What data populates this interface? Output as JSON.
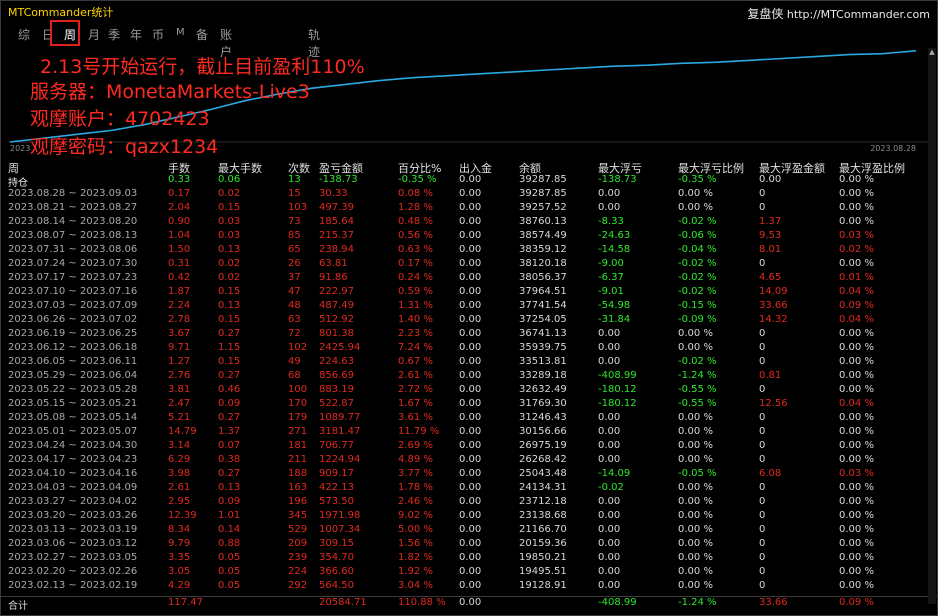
{
  "app_title": "MTCommander统计",
  "brand": {
    "name": "复盘侠",
    "url": "http://MTCommander.com"
  },
  "tabs": [
    "综",
    "日",
    "周",
    "月",
    "季",
    "年",
    "币",
    "M",
    "备",
    "账户",
    "轨迹"
  ],
  "active_tab": "周",
  "overlay_lines": [
    "2.13号开始运行，截止目前盈利110%",
    "服务器：MonetaMarkets-Live3",
    "观摩账户：4702423",
    "观摩密码：qazx1234"
  ],
  "chart_data": {
    "type": "area",
    "x_start_label": "2023",
    "x_end_label": "2023.08.28",
    "values": [
      0.0,
      0.04,
      0.08,
      0.12,
      0.18,
      0.26,
      0.34,
      0.43,
      0.5,
      0.56,
      0.6,
      0.64,
      0.67,
      0.69,
      0.71,
      0.73,
      0.75,
      0.77,
      0.79,
      0.8,
      0.82,
      0.83,
      0.85,
      0.87,
      0.89,
      0.91,
      0.92,
      0.95
    ]
  },
  "table": {
    "headers": [
      "周",
      "手数",
      "最大手数",
      "次数",
      "盈亏金额",
      "百分比%",
      "出入金",
      "余额",
      "最大浮亏",
      "最大浮亏比例",
      "最大浮盈金额",
      "最大浮盈比例"
    ],
    "rows": [
      [
        "持仓",
        "0.33",
        "0.06",
        "13",
        "-138.73",
        "-0.35 %",
        "0.00",
        "39287.85",
        "-138.73",
        "-0.35 %",
        "0.00",
        "0.00 %"
      ],
      [
        "2023.08.28 ~ 2023.09.03",
        "0.17",
        "0.02",
        "15",
        "30.33",
        "0.08 %",
        "0.00",
        "39287.85",
        "0.00",
        "0.00 %",
        "0",
        "0.00 %"
      ],
      [
        "2023.08.21 ~ 2023.08.27",
        "2.04",
        "0.15",
        "103",
        "497.39",
        "1.28 %",
        "0.00",
        "39257.52",
        "0.00",
        "0.00 %",
        "0",
        "0.00 %"
      ],
      [
        "2023.08.14 ~ 2023.08.20",
        "0.90",
        "0.03",
        "73",
        "185.64",
        "0.48 %",
        "0.00",
        "38760.13",
        "-8.33",
        "-0.02 %",
        "1.37",
        "0.00 %"
      ],
      [
        "2023.08.07 ~ 2023.08.13",
        "1.04",
        "0.03",
        "85",
        "215.37",
        "0.56 %",
        "0.00",
        "38574.49",
        "-24.63",
        "-0.06 %",
        "9.53",
        "0.03 %"
      ],
      [
        "2023.07.31 ~ 2023.08.06",
        "1.50",
        "0.13",
        "65",
        "238.94",
        "0.63 %",
        "0.00",
        "38359.12",
        "-14.58",
        "-0.04 %",
        "8.01",
        "0.02 %"
      ],
      [
        "2023.07.24 ~ 2023.07.30",
        "0.31",
        "0.02",
        "26",
        "63.81",
        "0.17 %",
        "0.00",
        "38120.18",
        "-9.00",
        "-0.02 %",
        "0",
        "0.00 %"
      ],
      [
        "2023.07.17 ~ 2023.07.23",
        "0.42",
        "0.02",
        "37",
        "91.86",
        "0.24 %",
        "0.00",
        "38056.37",
        "-6.37",
        "-0.02 %",
        "4.65",
        "0.01 %"
      ],
      [
        "2023.07.10 ~ 2023.07.16",
        "1.87",
        "0.15",
        "47",
        "222.97",
        "0.59 %",
        "0.00",
        "37964.51",
        "-9.01",
        "-0.02 %",
        "14.09",
        "0.04 %"
      ],
      [
        "2023.07.03 ~ 2023.07.09",
        "2.24",
        "0.13",
        "48",
        "487.49",
        "1.31 %",
        "0.00",
        "37741.54",
        "-54.98",
        "-0.15 %",
        "33.66",
        "0.09 %"
      ],
      [
        "2023.06.26 ~ 2023.07.02",
        "2.78",
        "0.15",
        "63",
        "512.92",
        "1.40 %",
        "0.00",
        "37254.05",
        "-31.84",
        "-0.09 %",
        "14.32",
        "0.04 %"
      ],
      [
        "2023.06.19 ~ 2023.06.25",
        "3.67",
        "0.27",
        "72",
        "801.38",
        "2.23 %",
        "0.00",
        "36741.13",
        "0.00",
        "0.00 %",
        "0",
        "0.00 %"
      ],
      [
        "2023.06.12 ~ 2023.06.18",
        "9.71",
        "1.15",
        "102",
        "2425.94",
        "7.24 %",
        "0.00",
        "35939.75",
        "0.00",
        "0.00 %",
        "0",
        "0.00 %"
      ],
      [
        "2023.06.05 ~ 2023.06.11",
        "1.27",
        "0.15",
        "49",
        "224.63",
        "0.67 %",
        "0.00",
        "33513.81",
        "0.00",
        "-0.02 %",
        "0",
        "0.00 %"
      ],
      [
        "2023.05.29 ~ 2023.06.04",
        "2.76",
        "0.27",
        "68",
        "856.69",
        "2.61 %",
        "0.00",
        "33289.18",
        "-408.99",
        "-1.24 %",
        "0.81",
        "0.00 %"
      ],
      [
        "2023.05.22 ~ 2023.05.28",
        "3.81",
        "0.46",
        "100",
        "883.19",
        "2.72 %",
        "0.00",
        "32632.49",
        "-180.12",
        "-0.55 %",
        "0",
        "0.00 %"
      ],
      [
        "2023.05.15 ~ 2023.05.21",
        "2.47",
        "0.09",
        "170",
        "522.87",
        "1.67 %",
        "0.00",
        "31769.30",
        "-180.12",
        "-0.55 %",
        "12.56",
        "0.04 %"
      ],
      [
        "2023.05.08 ~ 2023.05.14",
        "5.21",
        "0.27",
        "179",
        "1089.77",
        "3.61 %",
        "0.00",
        "31246.43",
        "0.00",
        "0.00 %",
        "0",
        "0.00 %"
      ],
      [
        "2023.05.01 ~ 2023.05.07",
        "14.79",
        "1.37",
        "271",
        "3181.47",
        "11.79 %",
        "0.00",
        "30156.66",
        "0.00",
        "0.00 %",
        "0",
        "0.00 %"
      ],
      [
        "2023.04.24 ~ 2023.04.30",
        "3.14",
        "0.07",
        "181",
        "706.77",
        "2.69 %",
        "0.00",
        "26975.19",
        "0.00",
        "0.00 %",
        "0",
        "0.00 %"
      ],
      [
        "2023.04.17 ~ 2023.04.23",
        "6.29",
        "0.38",
        "211",
        "1224.94",
        "4.89 %",
        "0.00",
        "26268.42",
        "0.00",
        "0.00 %",
        "0",
        "0.00 %"
      ],
      [
        "2023.04.10 ~ 2023.04.16",
        "3.98",
        "0.27",
        "188",
        "909.17",
        "3.77 %",
        "0.00",
        "25043.48",
        "-14.09",
        "-0.05 %",
        "6.08",
        "0.03 %"
      ],
      [
        "2023.04.03 ~ 2023.04.09",
        "2.61",
        "0.13",
        "163",
        "422.13",
        "1.78 %",
        "0.00",
        "24134.31",
        "-0.02",
        "0.00 %",
        "0",
        "0.00 %"
      ],
      [
        "2023.03.27 ~ 2023.04.02",
        "2.95",
        "0.09",
        "196",
        "573.50",
        "2.46 %",
        "0.00",
        "23712.18",
        "0.00",
        "0.00 %",
        "0",
        "0.00 %"
      ],
      [
        "2023.03.20 ~ 2023.03.26",
        "12.39",
        "1.01",
        "345",
        "1971.98",
        "9.02 %",
        "0.00",
        "23138.68",
        "0.00",
        "0.00 %",
        "0",
        "0.00 %"
      ],
      [
        "2023.03.13 ~ 2023.03.19",
        "8.34",
        "0.14",
        "529",
        "1007.34",
        "5.00 %",
        "0.00",
        "21166.70",
        "0.00",
        "0.00 %",
        "0",
        "0.00 %"
      ],
      [
        "2023.03.06 ~ 2023.03.12",
        "9.79",
        "0.88",
        "209",
        "309.15",
        "1.56 %",
        "0.00",
        "20159.36",
        "0.00",
        "0.00 %",
        "0",
        "0.00 %"
      ],
      [
        "2023.02.27 ~ 2023.03.05",
        "3.35",
        "0.05",
        "239",
        "354.70",
        "1.82 %",
        "0.00",
        "19850.21",
        "0.00",
        "0.00 %",
        "0",
        "0.00 %"
      ],
      [
        "2023.02.20 ~ 2023.02.26",
        "3.05",
        "0.05",
        "224",
        "366.60",
        "1.92 %",
        "0.00",
        "19495.51",
        "0.00",
        "0.00 %",
        "0",
        "0.00 %"
      ],
      [
        "2023.02.13 ~ 2023.02.19",
        "4.29",
        "0.05",
        "292",
        "564.50",
        "3.04 %",
        "0.00",
        "19128.91",
        "0.00",
        "0.00 %",
        "0",
        "0.00 %"
      ]
    ],
    "total": [
      "合计",
      "117.47",
      "",
      "",
      "20584.71",
      "110.88 %",
      "0.00",
      "",
      "-408.99",
      "-1.24 %",
      "33.66",
      "0.09 %"
    ]
  },
  "colors": {
    "curve": "#2aa8e0",
    "negative": "#2ee82e",
    "positive": "#e02a20",
    "highlight": "#e0201a"
  }
}
